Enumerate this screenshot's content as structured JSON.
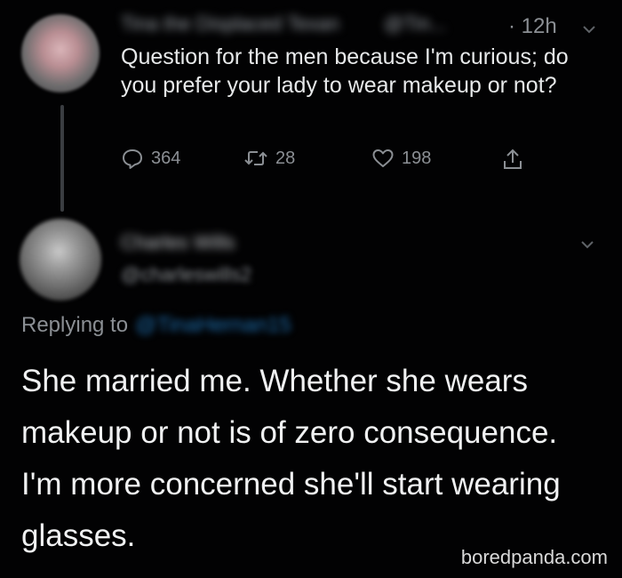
{
  "original_tweet": {
    "author_name": "Tina the Displaced Texan",
    "author_handle_partial": "@Tin...",
    "timestamp": "· 12h",
    "text": "Question for the men because I'm curious; do you prefer your lady to wear makeup or not?",
    "stats": {
      "replies": "364",
      "retweets": "28",
      "likes": "198"
    },
    "icons": {
      "reply": "comment-bubble-icon",
      "retweet": "retweet-icon",
      "like": "heart-icon",
      "share": "share-icon",
      "menu": "chevron-down-icon"
    }
  },
  "reply_tweet": {
    "author_name": "Charles Wills",
    "author_handle": "@charleswills2",
    "replying_label": "Replying to",
    "replying_to_handle": "@TinaHernan15",
    "text": "She married me. Whether she wears makeup or not is of zero consequence. I'm more concerned she'll start wearing glasses."
  },
  "watermark": "boredpanda.com",
  "colors": {
    "background": "#020203",
    "text_primary": "#e7e9ea",
    "text_secondary": "#8b8f94",
    "link": "#1d6fb0"
  }
}
